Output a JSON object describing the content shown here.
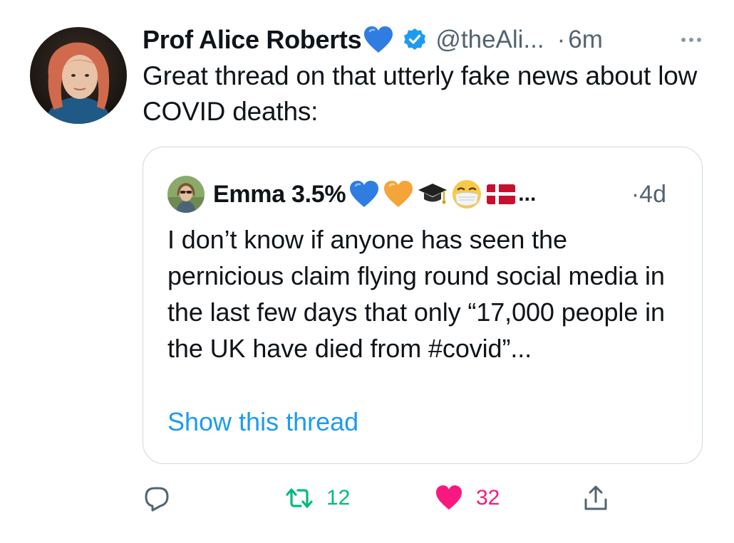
{
  "tweet": {
    "author_name": "Prof Alice Roberts",
    "handle": "@theAli...",
    "separator": "·",
    "time": "6m",
    "text": "Great thread on that utterly fake news about low COVID deaths:",
    "name_emoji": "blue-heart",
    "verified_icon": "verified-badge-icon",
    "more_icon": "more-options-icon"
  },
  "quote": {
    "author_name": "Emma 3.5%",
    "name_emojis": [
      "blue-heart",
      "orange-heart",
      "graduation-cap",
      "face-with-medical-mask",
      "denmark-flag"
    ],
    "name_ellipsis": "...",
    "time": "·4d",
    "text": "I don’t know if anyone has seen the pernicious claim flying round social media in the last few days that only “17,000 people in the UK have died from #covid”...",
    "show_thread": "Show this thread"
  },
  "actions": {
    "reply_icon": "reply-icon",
    "retweet_count": "12",
    "like_count": "32",
    "share_icon": "share-icon"
  },
  "colors": {
    "text_primary": "#0f1419",
    "text_secondary": "#536471",
    "link": "#1d9bf0",
    "retweet": "#00ba7c",
    "like": "#f91880",
    "border": "#cfd9de",
    "verified": "#1d9bf0"
  }
}
